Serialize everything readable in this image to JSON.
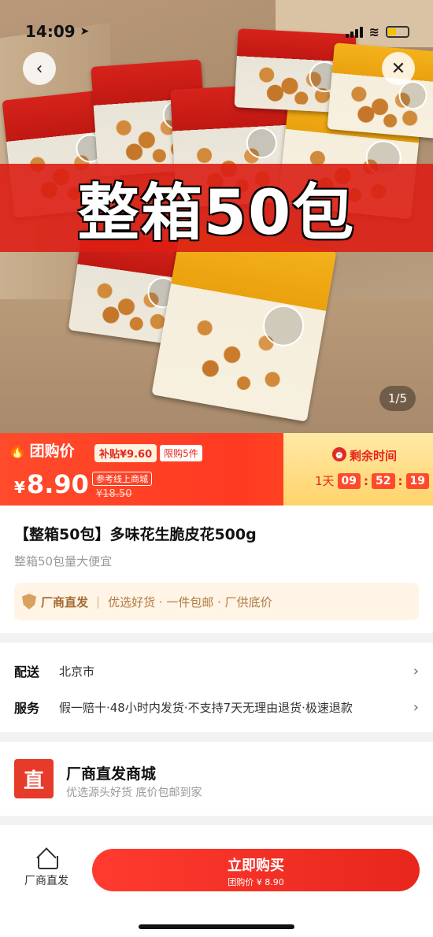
{
  "status_bar": {
    "time": "14:09"
  },
  "hero": {
    "banner_text": "整箱50包",
    "image_counter": "1/5"
  },
  "price_bar": {
    "group_label": "团购价",
    "subsidy": "补贴¥9.60",
    "limit": "限购5件",
    "currency": "¥",
    "price": "8.90",
    "reference_tag": "参考线上商城",
    "original_price": "¥18.50",
    "countdown_title": "剩余时间",
    "countdown_day": "1天",
    "countdown_hours": "09",
    "countdown_minutes": "52",
    "countdown_seconds": "19"
  },
  "product": {
    "title": "【整箱50包】多味花生脆皮花500g",
    "subtitle": "整箱50包量大便宜",
    "guarantee_brand": "厂商直发",
    "guarantee_text": "优选好货 · 一件包邮 · 厂供底价"
  },
  "delivery": {
    "ship_label": "配送",
    "ship_value": "北京市",
    "service_label": "服务",
    "service_value": "假一赔十·48小时内发货·不支持7天无理由退货·极速退款"
  },
  "shop": {
    "logo_char": "直",
    "name": "厂商直发商城",
    "desc": "优选源头好货 底价包邮到家"
  },
  "bottom_bar": {
    "home_label": "厂商直发",
    "buy_label": "立即购买",
    "buy_sub": "团购价 ¥ 8.90"
  },
  "colors": {
    "accent": "#e5261f",
    "countdown_bg": "#ffd36b",
    "guarantee_bg": "#fff4e6"
  },
  "icons": [
    "back-icon",
    "close-icon",
    "flame-icon",
    "alarm-clock-icon",
    "shield-icon",
    "chevron-right-icon",
    "home-icon"
  ]
}
